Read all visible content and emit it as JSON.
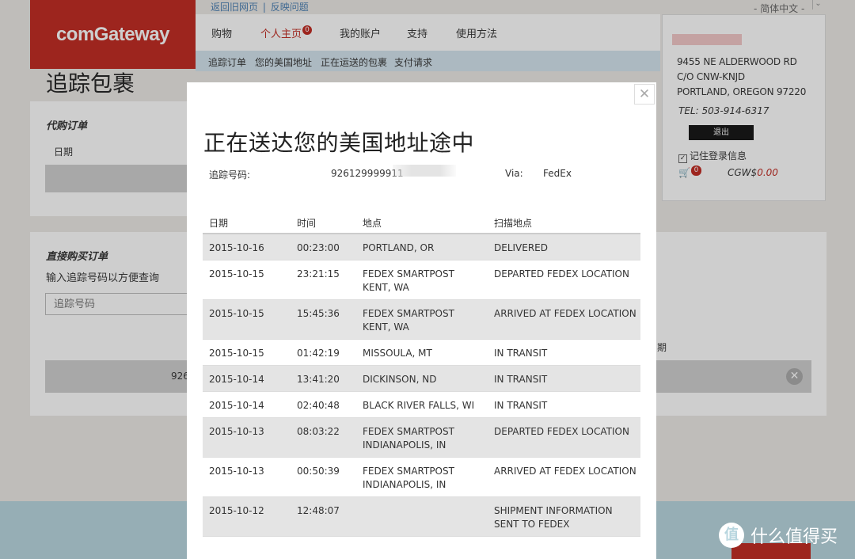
{
  "header": {
    "top_links": [
      "返回旧网页",
      "|",
      "反映问题"
    ],
    "language": "- 简体中文 -",
    "logo": "comGateway",
    "nav": [
      "购物",
      "个人主页",
      "我的账户",
      "支持",
      "使用方法"
    ],
    "nav_badge": "0",
    "subnav": [
      "追踪订单",
      "您的美国地址",
      "正在运送的包裹",
      "支付请求"
    ]
  },
  "page": {
    "title": "追踪包裹",
    "section_a_title": "代购订单",
    "section_a_col": "日期",
    "section_b_title": "直接购买订单",
    "section_b_hint": "输入追踪号码以方便查询",
    "search_placeholder": "追踪号码",
    "right_col_fragment": "期",
    "row_fragment": "926"
  },
  "account": {
    "address_lines": [
      "9455 NE ALDERWOOD RD",
      "C/O CNW-KNJD",
      "PORTLAND, OREGON 97220"
    ],
    "tel": "TEL: 503-914-6317",
    "logout": "退出",
    "remember": "记住登录信息",
    "cart_count": "0",
    "cgw_label": "CGW$",
    "cgw_amount": "0.00"
  },
  "watermark": "什么值得买",
  "modal": {
    "title": "正在送达您的美国地址途中",
    "tracking_label": "追踪号码:",
    "tracking_number": "926129999911",
    "via_label": "Via:",
    "via_value": "FedEx",
    "columns": [
      "日期",
      "时间",
      "地点",
      "扫描地点"
    ],
    "rows": [
      {
        "date": "2015-10-16",
        "time": "00:23:00",
        "location": "PORTLAND, OR",
        "scan": "DELIVERED"
      },
      {
        "date": "2015-10-15",
        "time": "23:21:15",
        "location": "FEDEX SMARTPOST KENT, WA",
        "scan": "DEPARTED FEDEX LOCATION"
      },
      {
        "date": "2015-10-15",
        "time": "15:45:36",
        "location": "FEDEX SMARTPOST KENT, WA",
        "scan": "ARRIVED AT FEDEX LOCATION"
      },
      {
        "date": "2015-10-15",
        "time": "01:42:19",
        "location": "MISSOULA, MT",
        "scan": "IN TRANSIT"
      },
      {
        "date": "2015-10-14",
        "time": "13:41:20",
        "location": "DICKINSON, ND",
        "scan": "IN TRANSIT"
      },
      {
        "date": "2015-10-14",
        "time": "02:40:48",
        "location": "BLACK RIVER FALLS, WI",
        "scan": "IN TRANSIT"
      },
      {
        "date": "2015-10-13",
        "time": "08:03:22",
        "location": "FEDEX SMARTPOST INDIANAPOLIS, IN",
        "scan": "DEPARTED FEDEX LOCATION"
      },
      {
        "date": "2015-10-13",
        "time": "00:50:39",
        "location": "FEDEX SMARTPOST INDIANAPOLIS, IN",
        "scan": "ARRIVED AT FEDEX LOCATION"
      },
      {
        "date": "2015-10-12",
        "time": "12:48:07",
        "location": "",
        "scan": "SHIPMENT INFORMATION SENT TO FEDEX"
      }
    ]
  }
}
